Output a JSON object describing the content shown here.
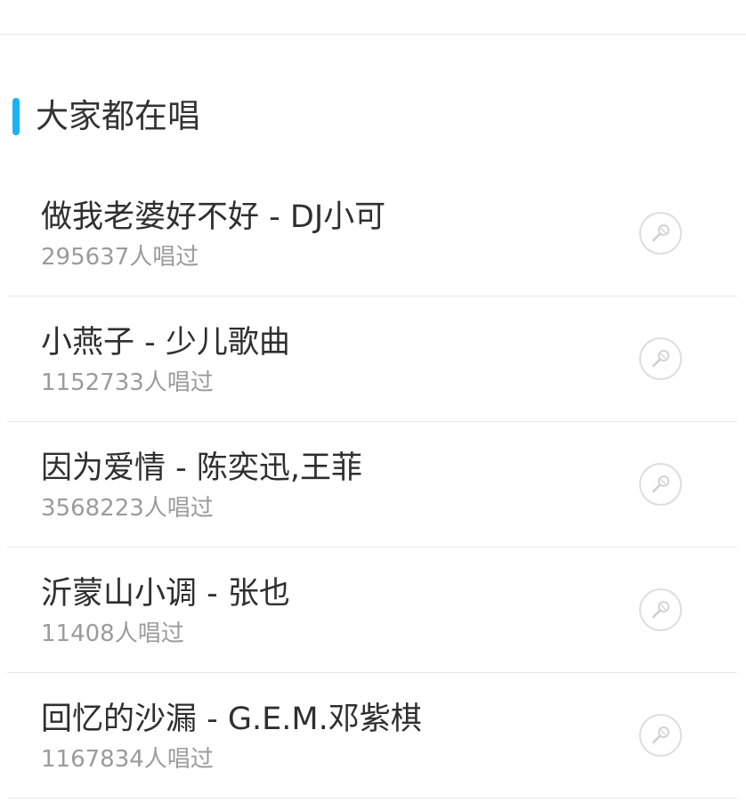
{
  "section": {
    "title": "大家都在唱"
  },
  "songs": [
    {
      "title": "做我老婆好不好 - DJ小可",
      "count": "295637人唱过",
      "icon": "microphone-icon"
    },
    {
      "title": "小燕子 - 少儿歌曲",
      "count": "1152733人唱过",
      "icon": "microphone-icon"
    },
    {
      "title": "因为爱情 - 陈奕迅,王菲",
      "count": "3568223人唱过",
      "icon": "microphone-icon"
    },
    {
      "title": "沂蒙山小调 - 张也",
      "count": "11408人唱过",
      "icon": "microphone-icon"
    },
    {
      "title": "回忆的沙漏 - G.E.M.邓紫棋",
      "count": "1167834人唱过",
      "icon": "microphone-icon"
    }
  ],
  "colors": {
    "accent": "#19b3f5",
    "title_text": "#2f2f2f",
    "secondary_text": "#9b9b9b",
    "divider": "#e8e8e8"
  }
}
